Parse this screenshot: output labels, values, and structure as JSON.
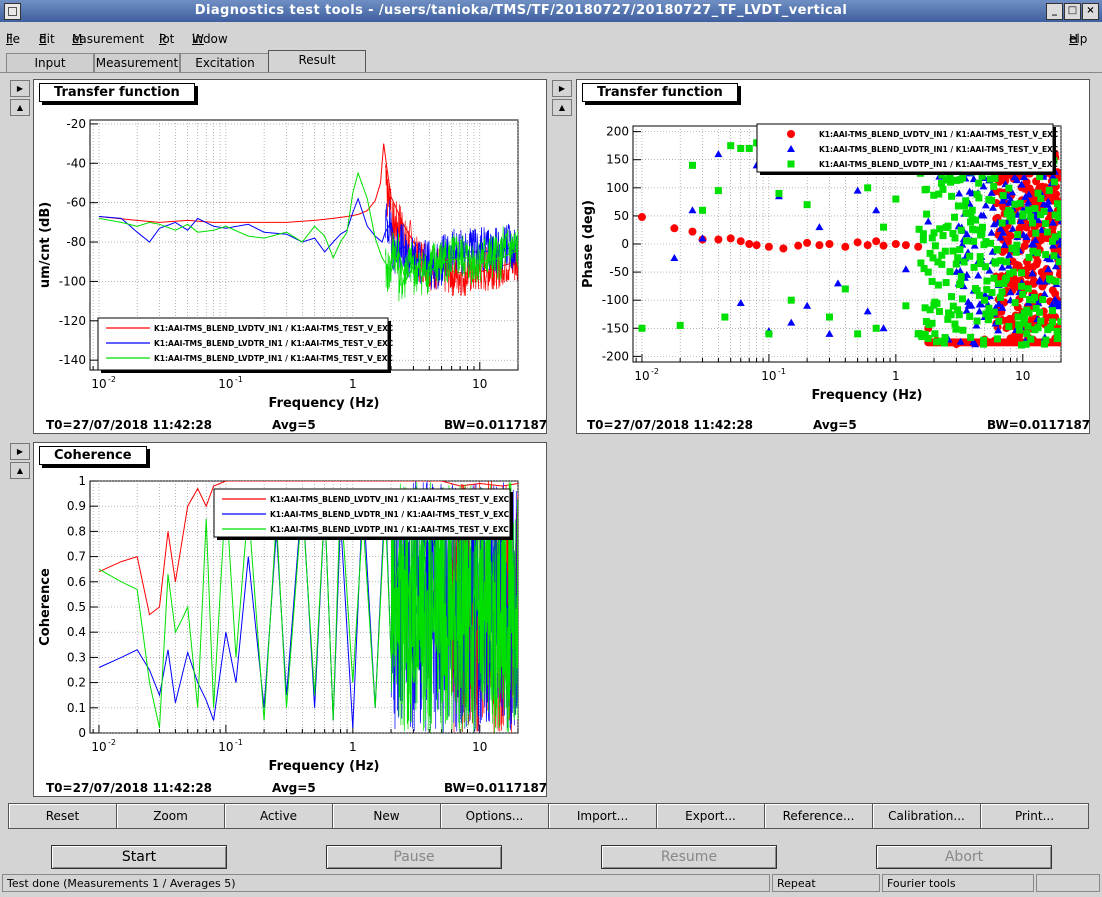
{
  "window": {
    "title": "Diagnostics test tools - /users/tanioka/TMS/TF/20180727/20180727_TF_LVDT_vertical",
    "controls": [
      "_",
      "□",
      "×"
    ]
  },
  "menu": {
    "items": [
      {
        "label": "File",
        "underline": "F",
        "rest": "ile"
      },
      {
        "label": "Edit",
        "underline": "E",
        "rest": "dit"
      },
      {
        "label": "Measurement",
        "underline": "M",
        "rest": "easurement"
      },
      {
        "label": "Plot",
        "underline": "P",
        "rest": "lot"
      },
      {
        "label": "Window",
        "underline": "W",
        "rest": "indow"
      }
    ],
    "help": {
      "underline": "H",
      "rest": "elp"
    }
  },
  "tabs": [
    "Input",
    "Measurement",
    "Excitation",
    "Result"
  ],
  "active_tab": "Result",
  "panels": {
    "tf_mag": {
      "title": "Transfer function",
      "t0": "T0=27/07/2018 11:42:28",
      "avg": "Avg=5",
      "bw": "BW=0.0117187"
    },
    "tf_phase": {
      "title": "Transfer function",
      "t0": "T0=27/07/2018 11:42:28",
      "avg": "Avg=5",
      "bw": "BW=0.0117187"
    },
    "coherence": {
      "title": "Coherence",
      "t0": "T0=27/07/2018 11:42:28",
      "avg": "Avg=5",
      "bw": "BW=0.0117187"
    }
  },
  "series_colors": {
    "lvdtv": "#ff0000",
    "lvdtr": "#0000ff",
    "lvdtp": "#00e000"
  },
  "chart_data": [
    {
      "type": "line",
      "title": "Transfer function",
      "xlabel": "Frequency (Hz)",
      "ylabel": "um/cnt (dB)",
      "xscale": "log",
      "xlim": [
        0.0085,
        20
      ],
      "ylim": [
        -145,
        -18
      ],
      "xticks": [
        {
          "v": 0.01,
          "l": "10"
        },
        {
          "v": 0.1,
          "l": "10"
        },
        {
          "v": 1,
          "l": "1"
        },
        {
          "v": 10,
          "l": "10"
        }
      ],
      "yticks": [
        -20,
        -40,
        -60,
        -80,
        -100,
        -120,
        -140
      ],
      "grid": true,
      "legend_position": "bottom-left",
      "series": [
        {
          "name": "K1:AAI-TMS_BLEND_LVDTV_IN1 / K1:AAI-TMS_TEST_V_EXC",
          "color": "#ff0000",
          "x": [
            0.01,
            0.02,
            0.03,
            0.05,
            0.08,
            0.12,
            0.2,
            0.3,
            0.5,
            0.7,
            0.9,
            1.1,
            1.3,
            1.5,
            1.65,
            1.75,
            1.85,
            2.0,
            2.5,
            3,
            4,
            5,
            6,
            8,
            10,
            12,
            15,
            20
          ],
          "y": [
            -67,
            -69,
            -70,
            -69,
            -70,
            -70,
            -70,
            -70,
            -69,
            -68,
            -67,
            -66,
            -64,
            -59,
            -50,
            -30,
            -42,
            -57,
            -71,
            -80,
            -89,
            -93,
            -95,
            -96,
            -95,
            -94,
            -92,
            -90
          ]
        },
        {
          "name": "K1:AAI-TMS_BLEND_LVDTR_IN1 / K1:AAI-TMS_TEST_V_EXC",
          "color": "#0000ff",
          "x": [
            0.01,
            0.015,
            0.02,
            0.025,
            0.03,
            0.04,
            0.05,
            0.06,
            0.08,
            0.1,
            0.15,
            0.2,
            0.3,
            0.4,
            0.5,
            0.6,
            0.7,
            0.8,
            0.9,
            1.0,
            1.1,
            1.3,
            1.5,
            1.7,
            1.8,
            2,
            2.2,
            2.5,
            3,
            4,
            5,
            6,
            8,
            10,
            15,
            20
          ],
          "y": [
            -67,
            -68,
            -75,
            -80,
            -73,
            -70,
            -74,
            -68,
            -72,
            -73,
            -71,
            -75,
            -76,
            -80,
            -78,
            -85,
            -80,
            -76,
            -74,
            -65,
            -58,
            -72,
            -77,
            -80,
            -75,
            -70,
            -85,
            -82,
            -88,
            -90,
            -92,
            -88,
            -85,
            -85,
            -84,
            -82
          ]
        },
        {
          "name": "K1:AAI-TMS_BLEND_LVDTP_IN1 / K1:AAI-TMS_TEST_V_EXC",
          "color": "#00e000",
          "x": [
            0.01,
            0.015,
            0.02,
            0.025,
            0.03,
            0.04,
            0.05,
            0.06,
            0.08,
            0.1,
            0.15,
            0.2,
            0.3,
            0.4,
            0.5,
            0.6,
            0.7,
            0.8,
            0.9,
            1.0,
            1.1,
            1.3,
            1.5,
            1.7,
            2,
            2.3,
            2.6,
            3,
            4,
            5,
            6,
            8,
            10,
            15,
            20
          ],
          "y": [
            -68,
            -70,
            -72,
            -70,
            -71,
            -74,
            -71,
            -75,
            -74,
            -72,
            -77,
            -78,
            -75,
            -80,
            -72,
            -77,
            -88,
            -80,
            -75,
            -55,
            -45,
            -58,
            -78,
            -88,
            -95,
            -85,
            -100,
            -92,
            -95,
            -91,
            -89,
            -88,
            -90,
            -88,
            -84
          ]
        }
      ]
    },
    {
      "type": "scatter",
      "title": "Transfer function",
      "xlabel": "Frequency (Hz)",
      "ylabel": "Phase (deg)",
      "xscale": "log",
      "xlim": [
        0.0085,
        20
      ],
      "ylim": [
        -210,
        210
      ],
      "xticks": [
        {
          "v": 0.01,
          "l": "10"
        },
        {
          "v": 0.1,
          "l": "10"
        },
        {
          "v": 1,
          "l": "1"
        },
        {
          "v": 10,
          "l": "10"
        }
      ],
      "yticks": [
        200,
        150,
        100,
        50,
        0,
        -50,
        -100,
        -150,
        -200
      ],
      "grid": true,
      "legend_position": "top-right",
      "series": [
        {
          "name": "K1:AAI-TMS_BLEND_LVDTV_IN1 / K1:AAI-TMS_TEST_V_EXC",
          "color": "#ff0000",
          "marker": "circle",
          "x": [
            0.01,
            0.018,
            0.025,
            0.03,
            0.04,
            0.05,
            0.06,
            0.07,
            0.08,
            0.1,
            0.13,
            0.17,
            0.2,
            0.25,
            0.3,
            0.4,
            0.5,
            0.6,
            0.7,
            0.8,
            1.0,
            1.2,
            1.5,
            1.8,
            2.1,
            2.5,
            3,
            4,
            5,
            6,
            8,
            10,
            12,
            15,
            18
          ],
          "y": [
            48,
            28,
            22,
            8,
            8,
            10,
            5,
            0,
            -2,
            -5,
            -8,
            -3,
            2,
            -2,
            0,
            -5,
            3,
            -2,
            5,
            -3,
            0,
            -2,
            -5,
            -150,
            -172,
            -175,
            -178,
            -175,
            -170,
            -172,
            -168,
            -175,
            -170,
            -172,
            -168
          ]
        },
        {
          "name": "K1:AAI-TMS_BLEND_LVDTR_IN1 / K1:AAI-TMS_TEST_V_EXC",
          "color": "#0000ff",
          "marker": "triangle",
          "x": [
            0.018,
            0.025,
            0.03,
            0.04,
            0.06,
            0.08,
            0.1,
            0.12,
            0.15,
            0.2,
            0.25,
            0.3,
            0.35,
            0.4,
            0.5,
            0.6,
            0.7,
            0.8,
            1.0,
            1.2,
            1.5,
            1.8,
            2.2,
            2.6,
            3,
            3.5,
            4,
            5,
            6,
            7,
            8,
            10
          ],
          "y": [
            -25,
            60,
            10,
            160,
            -105,
            140,
            -155,
            85,
            -140,
            -110,
            30,
            -160,
            -70,
            140,
            95,
            -120,
            60,
            -150,
            170,
            -45,
            -160,
            40,
            120,
            -170,
            150,
            -60,
            90,
            -130,
            130,
            20,
            -100,
            60
          ]
        },
        {
          "name": "K1:AAI-TMS_BLEND_LVDTP_IN1 / K1:AAI-TMS_TEST_V_EXC",
          "color": "#00e000",
          "marker": "square",
          "x": [
            0.01,
            0.02,
            0.025,
            0.03,
            0.04,
            0.045,
            0.05,
            0.06,
            0.07,
            0.08,
            0.1,
            0.12,
            0.15,
            0.2,
            0.25,
            0.3,
            0.4,
            0.5,
            0.6,
            0.7,
            0.8,
            1.0,
            1.2,
            1.5,
            1.8,
            2.0,
            2.3,
            2.7,
            3.2,
            4,
            5
          ],
          "y": [
            -150,
            -145,
            140,
            60,
            95,
            -130,
            175,
            170,
            170,
            180,
            -160,
            90,
            -100,
            70,
            170,
            -130,
            -80,
            -160,
            100,
            -150,
            30,
            80,
            -110,
            -160,
            -50,
            20,
            -20,
            110,
            -10,
            60,
            -100
          ]
        }
      ]
    },
    {
      "type": "line",
      "title": "Coherence",
      "xlabel": "Frequency (Hz)",
      "ylabel": "Coherence",
      "xscale": "log",
      "xlim": [
        0.0085,
        20
      ],
      "ylim": [
        0,
        1
      ],
      "xticks": [
        {
          "v": 0.01,
          "l": "10"
        },
        {
          "v": 0.1,
          "l": "10"
        },
        {
          "v": 1,
          "l": "1"
        },
        {
          "v": 10,
          "l": "10"
        }
      ],
      "yticks": [
        1,
        0.9,
        0.8,
        0.7,
        0.6,
        0.5,
        0.4,
        0.3,
        0.2,
        0.1,
        0
      ],
      "grid": true,
      "legend_position": "top-right",
      "series": [
        {
          "name": "K1:AAI-TMS_BLEND_LVDTV_IN1 / K1:AAI-TMS_TEST_V_EXC",
          "color": "#ff0000",
          "x": [
            0.01,
            0.015,
            0.02,
            0.025,
            0.03,
            0.035,
            0.04,
            0.05,
            0.06,
            0.07,
            0.08,
            0.1,
            0.15,
            0.2,
            0.3,
            0.5,
            0.7,
            1.0,
            1.5,
            2,
            3,
            5,
            7,
            10,
            15,
            20
          ],
          "y": [
            0.64,
            0.68,
            0.7,
            0.47,
            0.5,
            0.8,
            0.6,
            0.9,
            0.97,
            0.9,
            0.98,
            1,
            1,
            1,
            1,
            1,
            1,
            1,
            1,
            1,
            1,
            1,
            0.98,
            0.99,
            0.98,
            0.99
          ]
        },
        {
          "name": "K1:AAI-TMS_BLEND_LVDTR_IN1 / K1:AAI-TMS_TEST_V_EXC",
          "color": "#0000ff",
          "x": [
            0.01,
            0.015,
            0.02,
            0.025,
            0.03,
            0.035,
            0.04,
            0.05,
            0.06,
            0.07,
            0.08,
            0.1,
            0.12,
            0.15,
            0.2,
            0.25,
            0.3,
            0.4,
            0.5,
            0.6,
            0.7,
            0.8,
            1,
            1.2,
            1.5,
            1.8,
            2,
            2.5,
            3,
            4,
            5
          ],
          "y": [
            0.26,
            0.3,
            0.33,
            0.25,
            0.15,
            0.33,
            0.12,
            0.32,
            0.2,
            0.13,
            0.05,
            0.4,
            0.2,
            0.7,
            0.1,
            0.8,
            0.15,
            0.95,
            0.1,
            0.9,
            0.05,
            0.85,
            0.02,
            0.95,
            0.1,
            0.95,
            0.3,
            0.85,
            0.4,
            0.9,
            0.6
          ]
        },
        {
          "name": "K1:AAI-TMS_BLEND_LVDTP_IN1 / K1:AAI-TMS_TEST_V_EXC",
          "color": "#00e000",
          "x": [
            0.01,
            0.015,
            0.02,
            0.025,
            0.03,
            0.035,
            0.04,
            0.045,
            0.05,
            0.06,
            0.07,
            0.08,
            0.1,
            0.12,
            0.15,
            0.2,
            0.25,
            0.3,
            0.4,
            0.5,
            0.6,
            0.7,
            0.8,
            1,
            1.2,
            1.5,
            1.8,
            2,
            2.5,
            3,
            4,
            5
          ],
          "y": [
            0.65,
            0.6,
            0.57,
            0.2,
            0.02,
            0.63,
            0.4,
            0.45,
            0.5,
            0.1,
            0.85,
            0.1,
            0.95,
            0.3,
            0.9,
            0.05,
            0.85,
            0.1,
            0.92,
            0.15,
            0.9,
            0.05,
            0.95,
            0.2,
            0.85,
            0.1,
            0.9,
            0.3,
            0.95,
            0.2,
            0.9,
            0.5
          ]
        }
      ]
    }
  ],
  "buttons": [
    "Reset",
    "Zoom",
    "Active",
    "New",
    "Options...",
    "Import...",
    "Export...",
    "Reference...",
    "Calibration...",
    "Print..."
  ],
  "big_buttons": [
    {
      "label": "Start",
      "enabled": true
    },
    {
      "label": "Pause",
      "enabled": false
    },
    {
      "label": "Resume",
      "enabled": false
    },
    {
      "label": "Abort",
      "enabled": false
    }
  ],
  "status": {
    "message": "Test done (Measurements 1 / Averages 5)",
    "mode": "Repeat",
    "tool": "Fourier tools"
  }
}
